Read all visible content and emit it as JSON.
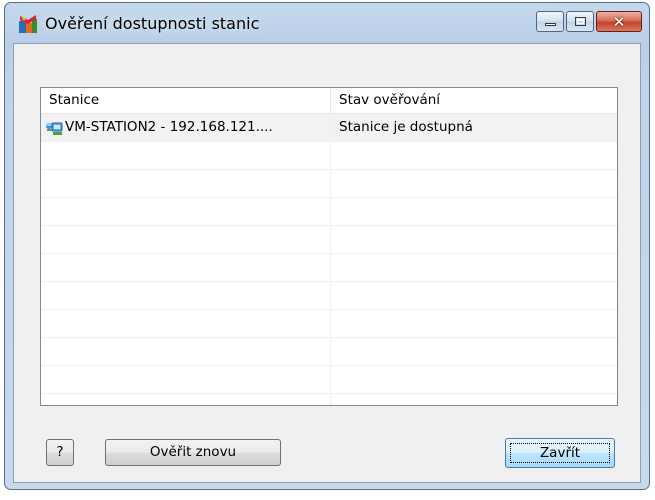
{
  "window": {
    "title": "Ověření dostupnosti stanic",
    "icon": "avg-logo-icon",
    "controls": [
      "minimize-icon",
      "maximize-icon",
      "close-icon"
    ],
    "close_glyph": "✕"
  },
  "list": {
    "columns": [
      "Stanice",
      "Stav ověřování"
    ],
    "rows": [
      {
        "station": "VM-STATION2 - 192.168.121....",
        "status": "Stanice je dostupná",
        "icon": "network-station-icon",
        "selected": true
      }
    ],
    "empty_row_count": 10
  },
  "buttons": {
    "help": "?",
    "recheck": "Ověřit znovu",
    "close": "Zavřít"
  },
  "colors": {
    "frame": "#bfd3ea",
    "client": "#f0f0f0",
    "close_button": "#c4432a",
    "default_button_border": "#3c7fb1"
  }
}
